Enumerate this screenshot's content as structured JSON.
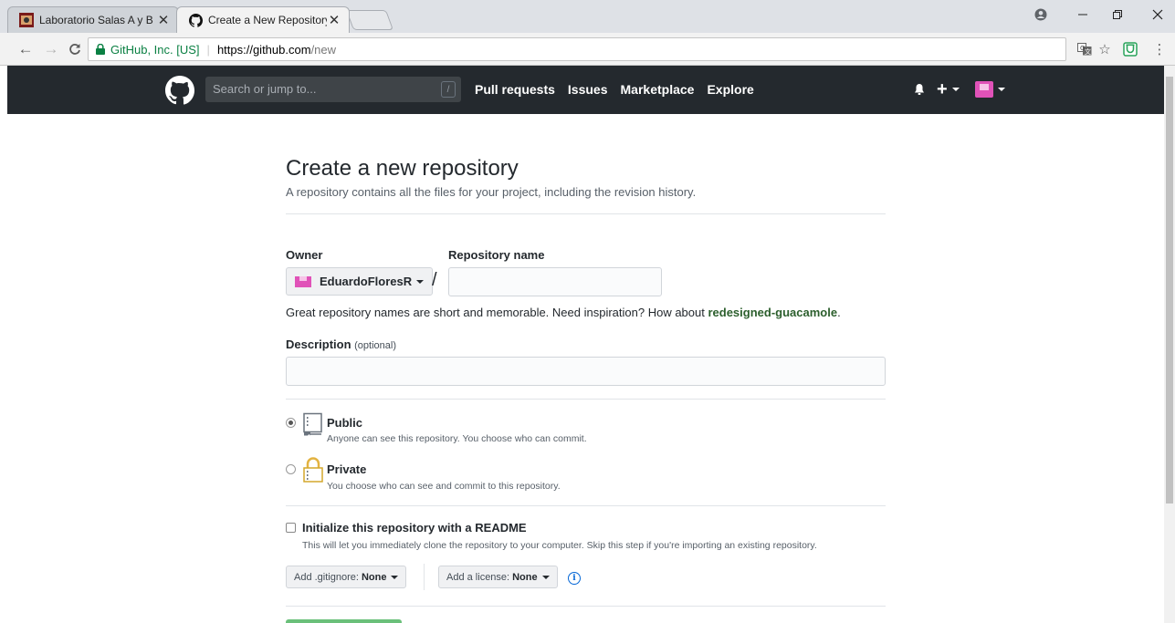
{
  "browser": {
    "tabs": [
      {
        "title": "Laboratorio Salas A y B",
        "active": false
      },
      {
        "title": "Create a New Repository",
        "active": true
      }
    ],
    "omnibox": {
      "secure_label": "GitHub, Inc. [US]",
      "url_host": "https://github.com",
      "url_path": "/new"
    }
  },
  "gh_header": {
    "search_placeholder": "Search or jump to...",
    "search_key": "/",
    "nav": [
      "Pull requests",
      "Issues",
      "Marketplace",
      "Explore"
    ],
    "plus": "+"
  },
  "form": {
    "title": "Create a new repository",
    "subtitle": "A repository contains all the files for your project, including the revision history.",
    "owner_label": "Owner",
    "owner_value": "EduardoFloresR",
    "slash": "/",
    "repo_name_label": "Repository name",
    "repo_name_value": "",
    "hint_prefix": "Great repository names are short and memorable. Need inspiration? How about ",
    "hint_suggestion": "redesigned-guacamole",
    "hint_suffix": ".",
    "description_label": "Description",
    "description_optional": "(optional)",
    "description_value": "",
    "visibility": [
      {
        "title": "Public",
        "desc": "Anyone can see this repository. You choose who can commit.",
        "checked": true
      },
      {
        "title": "Private",
        "desc": "You choose who can see and commit to this repository.",
        "checked": false
      }
    ],
    "readme_label": "Initialize this repository with a README",
    "readme_desc": "This will let you immediately clone the repository to your computer. Skip this step if you're importing an existing repository.",
    "gitignore_label": "Add .gitignore:",
    "gitignore_value": "None",
    "license_label": "Add a license:",
    "license_value": "None",
    "info": "i"
  },
  "colors": {
    "header_bg": "#24292e",
    "suggestion": "#2c5f2d",
    "create_button": "#6ac07a",
    "secure": "#0b8043"
  }
}
